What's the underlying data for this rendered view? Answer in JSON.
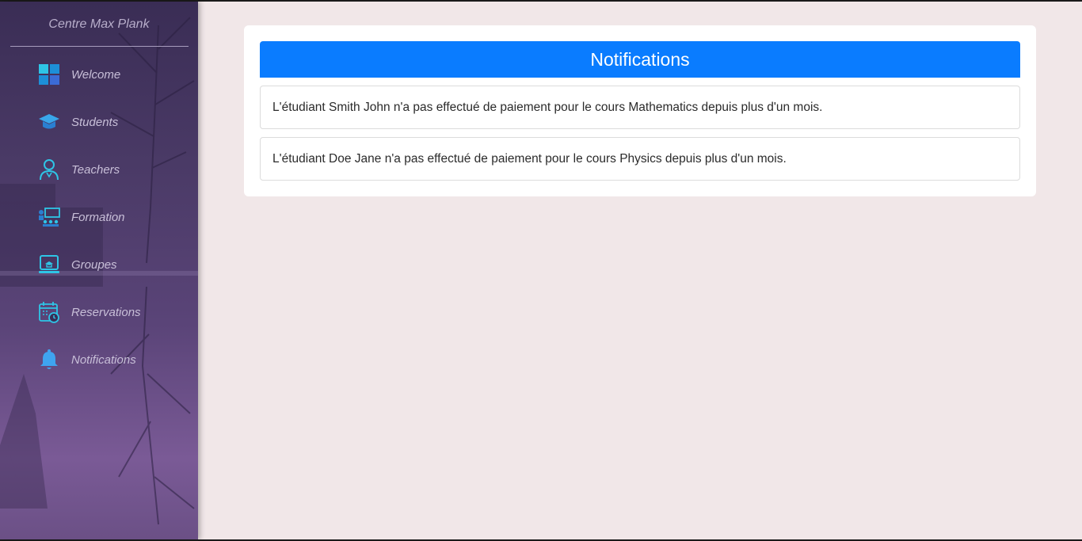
{
  "sidebar": {
    "brand": "Centre Max Plank",
    "items": [
      {
        "label": "Welcome",
        "icon": "dashboard-grid-icon"
      },
      {
        "label": "Students",
        "icon": "graduation-cap-icon"
      },
      {
        "label": "Teachers",
        "icon": "teacher-icon"
      },
      {
        "label": "Formation",
        "icon": "classroom-icon"
      },
      {
        "label": "Groupes",
        "icon": "group-laptop-icon"
      },
      {
        "label": "Reservations",
        "icon": "calendar-clock-icon"
      },
      {
        "label": "Notifications",
        "icon": "bell-icon"
      }
    ]
  },
  "main": {
    "title": "Notifications",
    "notifications": [
      "L'étudiant Smith John n'a pas effectué de paiement pour le cours Mathematics depuis plus d'un mois.",
      "L'étudiant Doe Jane n'a pas effectué de paiement pour le cours Physics depuis plus d'un mois."
    ]
  },
  "colors": {
    "header_blue": "#0a7cff",
    "page_background": "#f1e7e8",
    "sidebar_purple": "#4a3a66"
  }
}
